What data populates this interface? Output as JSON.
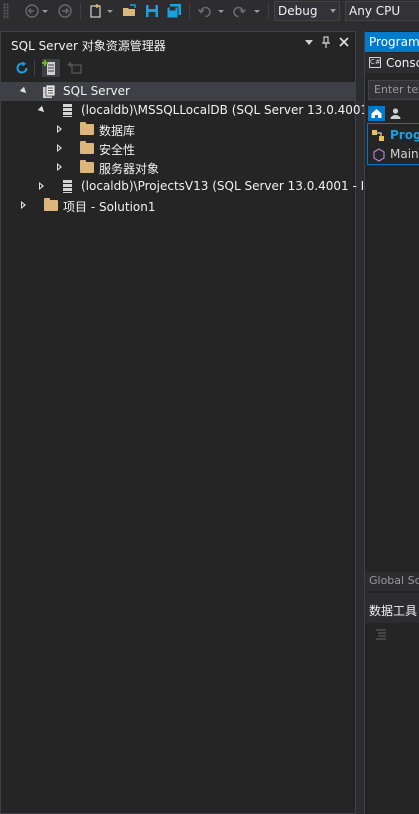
{
  "toolbar": {
    "config_value": "Debug",
    "platform_value": "Any CPU"
  },
  "explorer": {
    "title": "SQL Server 对象资源管理器",
    "tree": {
      "root_label": "SQL Server",
      "node1_label": "(localdb)\\MSSQLLocalDB (SQL Server 13.0.4001",
      "node1_children": [
        "数据库",
        "安全性",
        "服务器对象"
      ],
      "node2_label": "(localdb)\\ProjectsV13 (SQL Server 13.0.4001 - I",
      "node3_label": "项目 - Solution1"
    }
  },
  "right_pane": {
    "tab_title": "Program",
    "solution_tab": "Consc",
    "search_placeholder": "Enter tex",
    "item1": "Prog",
    "item2": "Main",
    "global_label": "Global Sc",
    "data_tools_label": "数据工具"
  },
  "colors": {
    "accent": "#007acc",
    "selection": "#3f3f46",
    "folder": "#dcb67a",
    "refresh": "#1ba1e2",
    "add_server": "#68b723"
  }
}
